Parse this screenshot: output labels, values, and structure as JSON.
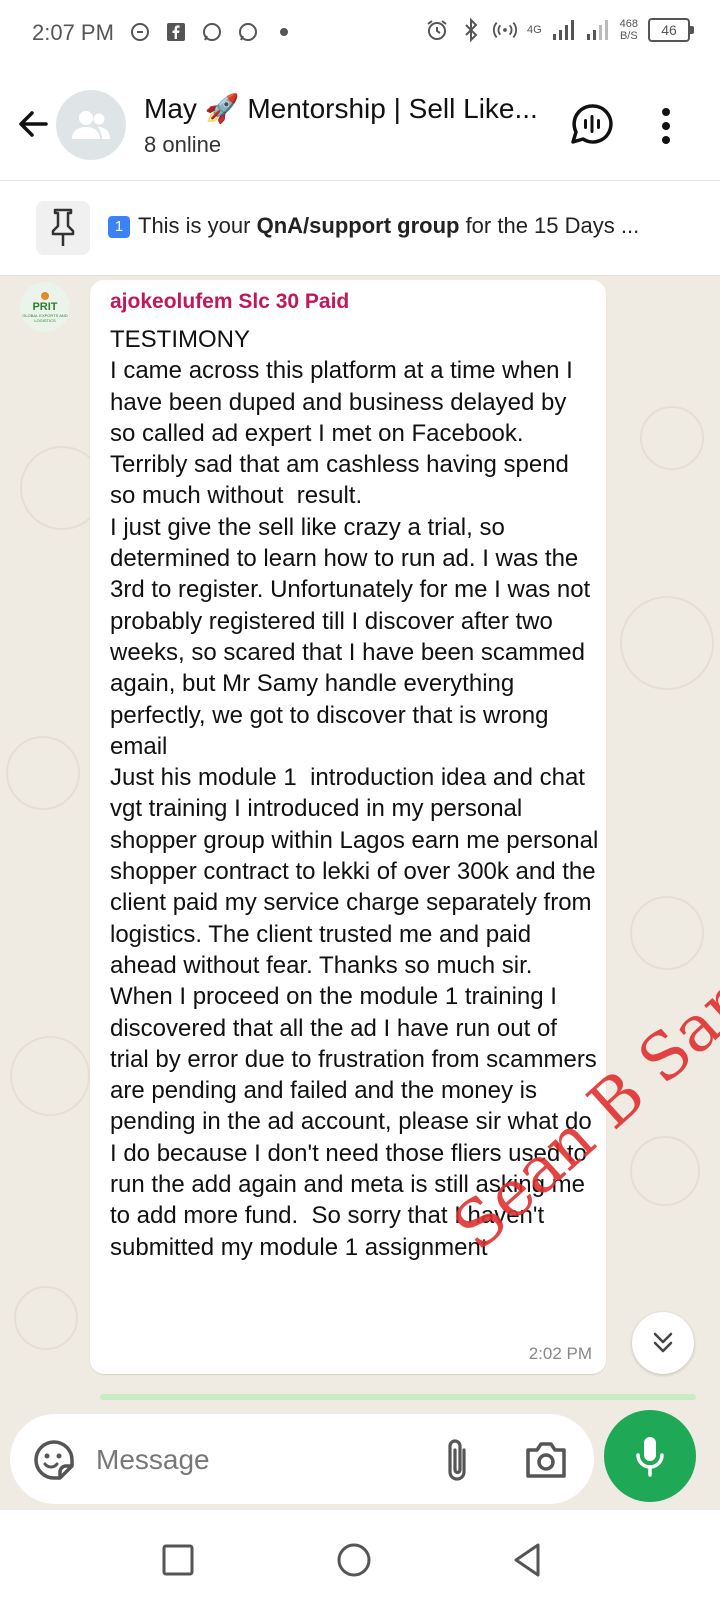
{
  "status": {
    "time": "2:07 PM",
    "network": "4G",
    "net_speed_value": "468",
    "net_speed_unit": "B/S",
    "battery": "46"
  },
  "header": {
    "title": "May 🚀 Mentorship | Sell Like...",
    "subtitle": "8 online"
  },
  "pinned": {
    "badge": "1",
    "prefix": "This is your ",
    "bold": "QnA/support  group",
    "suffix": " for the 15 Days ..."
  },
  "message": {
    "sender": "ajokeolufem Slc 30 Paid",
    "avatar_text": "PRIT",
    "avatar_subtext": "GLOBAL EXPORTS AND LOGISTICS",
    "text": "TESTIMONY\nI came across this platform at a time when I have been duped and business delayed by  so called ad expert I met on Facebook. Terribly sad that am cashless having spend so much without  result.\nI just give the sell like crazy a trial, so determined to learn how to run ad. I was the 3rd to register. Unfortunately for me I was not  probably registered till I discover after two weeks, so scared that I have been scammed again, but Mr Samy handle everything perfectly, we got to discover that is wrong email\nJust his module 1  introduction idea and chat vgt training I introduced in my personal shopper group within Lagos earn me personal shopper contract to lekki of over 300k and the client paid my service charge separately from logistics. The client trusted me and paid ahead without fear. Thanks so much sir.\nWhen I proceed on the module 1 training I discovered that all the ad I have run out of trial by error due to frustration from scammers are pending and failed and the money is pending in the ad account, please sir what do I do because I don't need those fliers used to run the add again and meta is still asking me to add more fund.  So sorry that I haven't submitted my module 1 assignment",
    "time": "2:02 PM"
  },
  "watermark": "Sean B Samy",
  "composer": {
    "placeholder": "Message"
  },
  "colors": {
    "sender_name": "#c2185b",
    "mic_button": "#1fa855",
    "chat_background": "#efeae2",
    "watermark": "#e03030"
  }
}
